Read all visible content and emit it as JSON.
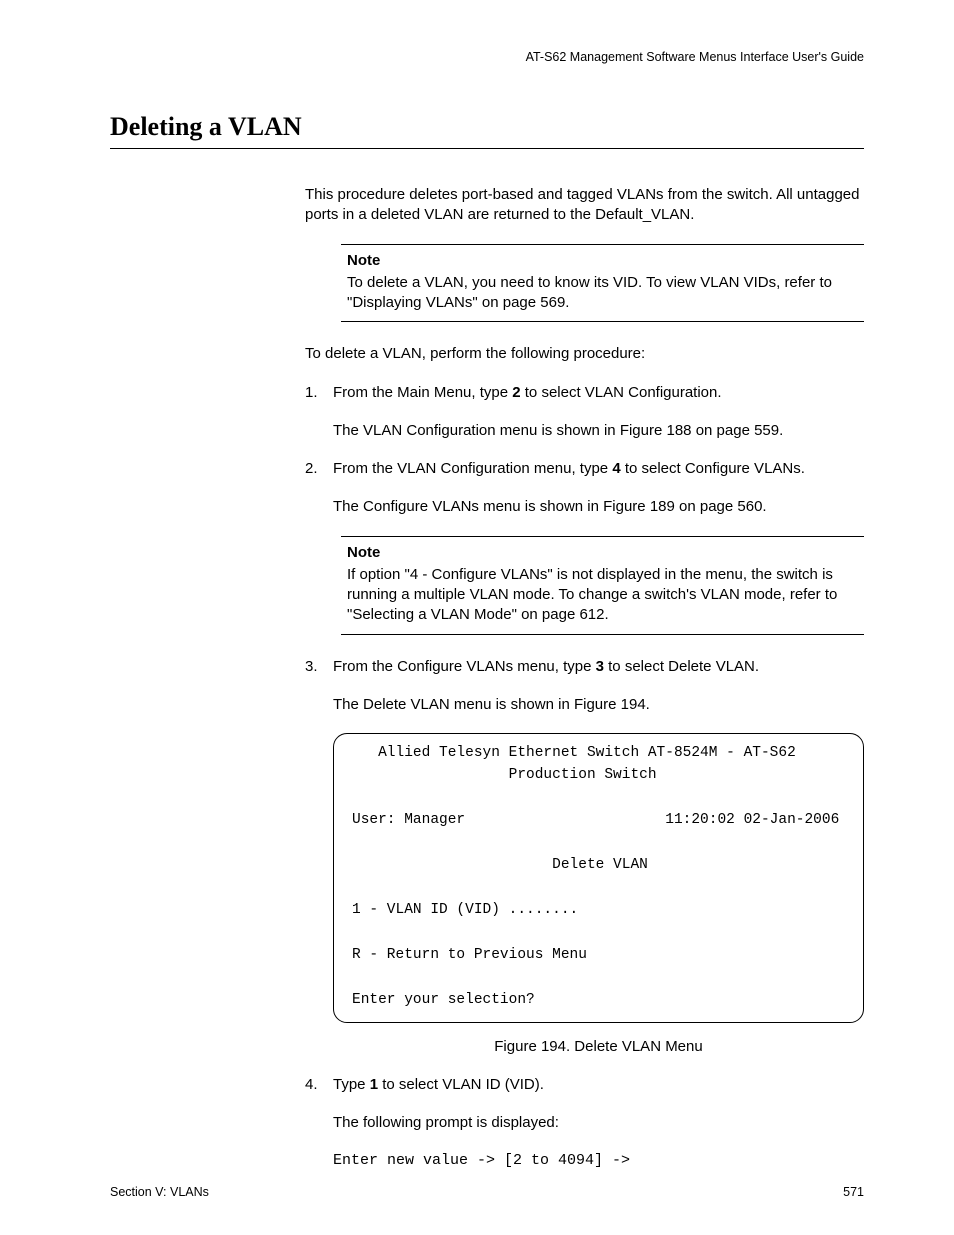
{
  "header": {
    "guide": "AT-S62 Management Software Menus Interface User's Guide"
  },
  "title": "Deleting a VLAN",
  "intro": "This procedure deletes port-based and tagged VLANs from the switch. All untagged ports in a deleted VLAN are returned to the Default_VLAN.",
  "note1": {
    "label": "Note",
    "text": "To delete a VLAN, you need to know its VID. To view VLAN VIDs, refer to \"Displaying VLANs\" on page 569."
  },
  "lead": "To delete a VLAN, perform the following procedure:",
  "steps": {
    "s1": {
      "num": "1.",
      "line1a": "From the Main Menu, type ",
      "line1b": "2",
      "line1c": " to select VLAN Configuration.",
      "line2": "The VLAN Configuration menu is shown in Figure 188 on page 559."
    },
    "s2": {
      "num": "2.",
      "line1a": "From the VLAN Configuration menu, type ",
      "line1b": "4",
      "line1c": " to select Configure VLANs.",
      "line2": "The Configure VLANs menu is shown in Figure 189 on page 560."
    },
    "s3": {
      "num": "3.",
      "line1a": "From the Configure VLANs menu, type ",
      "line1b": "3",
      "line1c": " to select Delete VLAN.",
      "line2": "The Delete VLAN menu is shown in Figure 194."
    },
    "s4": {
      "num": "4.",
      "line1a": "Type ",
      "line1b": "1",
      "line1c": " to select VLAN ID (VID).",
      "line2": "The following prompt is displayed:",
      "prompt": "Enter new value -> [2 to 4094] ->"
    }
  },
  "note2": {
    "label": "Note",
    "text": "If option \"4 - Configure VLANs\" is not displayed in the menu, the switch is running a multiple VLAN mode. To change a switch's VLAN mode, refer to \"Selecting a VLAN Mode\" on page 612."
  },
  "terminal": {
    "line1": "   Allied Telesyn Ethernet Switch AT-8524M - AT-S62",
    "line2": "                  Production Switch",
    "line3": "User: Manager                       11:20:02 02-Jan-2006",
    "line4": "                       Delete VLAN",
    "line5": "1 - VLAN ID (VID) ........",
    "line6": "R - Return to Previous Menu",
    "line7": "Enter your selection?"
  },
  "figcaption": "Figure 194. Delete VLAN Menu",
  "footer": {
    "section": "Section V: VLANs",
    "page": "571"
  }
}
